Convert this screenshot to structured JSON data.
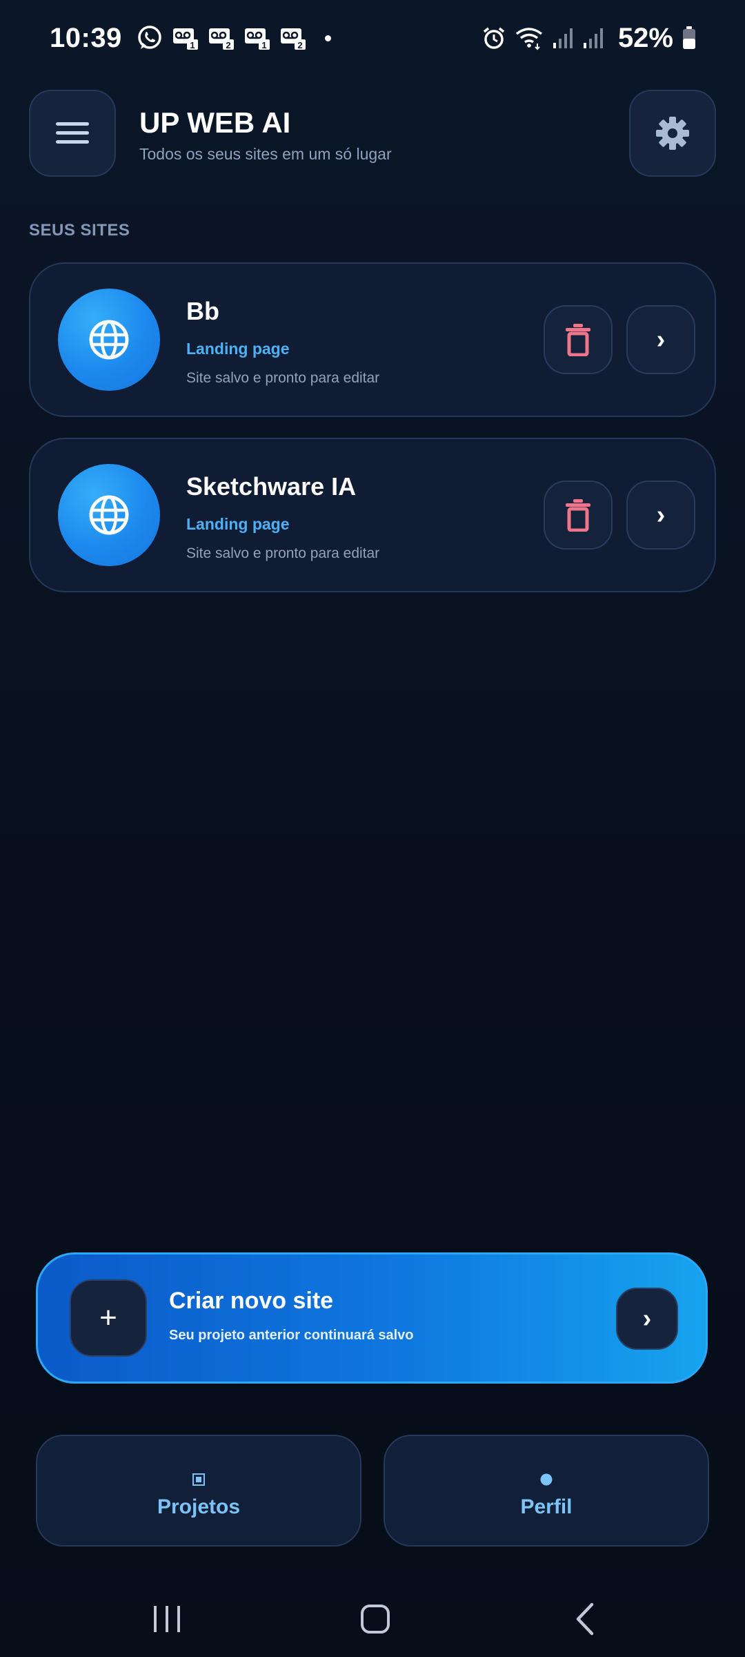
{
  "status_bar": {
    "time": "10:39",
    "battery": "52%",
    "icons": [
      "whatsapp-icon",
      "voicemail-icon",
      "voicemail-icon",
      "voicemail-icon",
      "voicemail-icon",
      "alarm-icon",
      "wifi-icon",
      "signal-icon",
      "signal-icon",
      "battery-icon"
    ],
    "voicemail_badges": [
      "1",
      "2",
      "1",
      "2"
    ]
  },
  "header": {
    "title": "UP WEB AI",
    "subtitle": "Todos os seus sites em um só lugar"
  },
  "section_label": "SEUS SITES",
  "sites": [
    {
      "name": "Bb",
      "type": "Landing page",
      "status": "Site salvo e pronto para editar"
    },
    {
      "name": "Sketchware IA",
      "type": "Landing page",
      "status": "Site salvo e pronto para editar"
    }
  ],
  "create": {
    "plus": "+",
    "title": "Criar novo site",
    "subtitle": "Seu projeto anterior continuará salvo",
    "go": "›"
  },
  "chevron": "›",
  "tabs": [
    {
      "label": "Projetos"
    },
    {
      "label": "Perfil"
    }
  ],
  "colors": {
    "background": "#08111f",
    "card": "#0f1c33",
    "accent": "#1c88ee",
    "link": "#4db1f5",
    "delete": "#f0758a",
    "tab_label": "#7cc4f7"
  }
}
